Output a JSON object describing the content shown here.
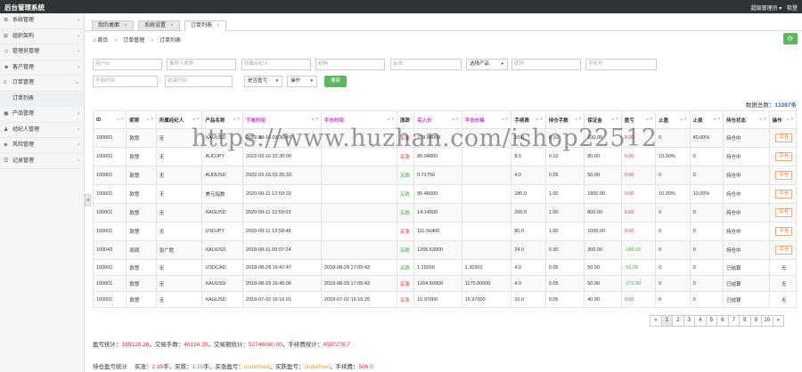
{
  "topbar": {
    "title": "后台管理系统",
    "user": "超级管理员",
    "user_arrow": "▾",
    "logout": "软登"
  },
  "sidebar": {
    "items": [
      {
        "label": "系统管理",
        "icon": "gear-icon",
        "glyph": "⚙",
        "expanded": false
      },
      {
        "label": "组织架构",
        "icon": "org-icon",
        "glyph": "⊞",
        "expanded": false
      },
      {
        "label": "管理员管理",
        "icon": "user-icon",
        "glyph": "☺",
        "expanded": false
      },
      {
        "label": "客户管理",
        "icon": "customer-icon",
        "glyph": "☻",
        "expanded": false
      },
      {
        "label": "订单管理",
        "icon": "order-icon",
        "glyph": "≡",
        "expanded": true
      },
      {
        "label": "订单列表",
        "sub": true
      },
      {
        "label": "产品管理",
        "icon": "product-icon",
        "glyph": "▣",
        "expanded": false
      },
      {
        "label": "经纪人管理",
        "icon": "agent-icon",
        "glyph": "♟",
        "expanded": false
      },
      {
        "label": "风险管理",
        "icon": "risk-icon",
        "glyph": "◈",
        "expanded": false
      },
      {
        "label": "记录管理",
        "icon": "record-icon",
        "glyph": "☰",
        "expanded": false
      }
    ],
    "collapse": "◂"
  },
  "tabs": [
    {
      "label": "我的桌面",
      "active": false
    },
    {
      "label": "系统设置",
      "active": false
    },
    {
      "label": "订单列表",
      "active": true
    }
  ],
  "tab_close": "×",
  "breadcrumb": {
    "home": "首页",
    "level1": "订单管理",
    "level2": "订单列表",
    "sep": ">"
  },
  "refresh_glyph": "⟳",
  "filters": {
    "user_id": "用户Id",
    "recommender": "推荐人昵称",
    "agent": "所属经纪人",
    "org": "机构",
    "member": "会员",
    "product": "选择产品",
    "nickname": "昵称",
    "phone": "手机号",
    "start_time": "开始时间",
    "end_time": "结束时间",
    "holding": "是否盈亏",
    "operation": "操作",
    "search": "搜索",
    "range_sep": "-"
  },
  "total": {
    "label": "数据总数：",
    "value": "13287",
    "unit": "条"
  },
  "table": {
    "headers": [
      "ID",
      "昵称",
      "所属经纪人",
      "产品名称",
      "下单时间",
      "平仓时间",
      "涨跌",
      "买入价",
      "平仓价格",
      "手续费",
      "持仓手数",
      "保证金",
      "盈亏",
      "止盈",
      "止损",
      "持仓状态",
      "操作"
    ],
    "rows": [
      [
        "100001",
        "款慧",
        "无",
        "XAUUSD",
        "2022-03-16 02:30:47",
        "",
        "买涨",
        "779.96000",
        "",
        "10.0",
        "0.10",
        "100.00",
        "0.00",
        "0",
        "40.00%",
        "持仓中",
        "平仓"
      ],
      [
        "100001",
        "款慧",
        "无",
        "AUDJPY",
        "2022-03-16 02:30:09",
        "",
        "买涨",
        "80.04800",
        "",
        "8.0",
        "0.10",
        "80.00",
        "0.00",
        "10.00%",
        "0",
        "持仓中",
        "平仓"
      ],
      [
        "100001",
        "款慧",
        "无",
        "AUDUSD",
        "2022-03-16 02:25:33",
        "",
        "买跌",
        "0.71750",
        "",
        "4.0",
        "0.05",
        "50.00",
        "0.00",
        "0",
        "0",
        "持仓中",
        "平仓"
      ],
      [
        "100001",
        "款慧",
        "无",
        "美元指数",
        "2020-09-11 12:59:19",
        "",
        "买跌",
        "95.48000",
        "",
        "180.0",
        "1.00",
        "1800.00",
        "0.00",
        "10.00%",
        "10.00%",
        "持仓中",
        "平仓"
      ],
      [
        "100001",
        "款慧",
        "无",
        "XAGUSD",
        "2020-09-11 12:59:03",
        "",
        "买跌",
        "14.14500",
        "",
        "200.0",
        "1.00",
        "800.00",
        "0.00",
        "0",
        "0",
        "持仓中",
        "平仓"
      ],
      [
        "100001",
        "款慧",
        "无",
        "USDJPY",
        "2020-09-11 12:58:48",
        "",
        "买涨",
        "111.56400",
        "",
        "80.0",
        "1.00",
        "1000.00",
        "0.00",
        "0",
        "0",
        "持仓中",
        "平仓"
      ],
      [
        "100043",
        "闻闻",
        "张广胜",
        "XAUUSD",
        "2018-09-11 00:07:24",
        "",
        "买跌",
        "1206.63000",
        "",
        "24.0",
        "0.30",
        "300.00",
        "-186.10",
        "0",
        "0",
        "持仓中",
        "平仓"
      ],
      [
        "100001",
        "款慧",
        "无",
        "USDCAD",
        "2018-08-29 16:47:47",
        "2018-08-29 17:05:43",
        "买跌",
        "1.29260",
        "1.30301",
        "4.0",
        "0.05",
        "50.00",
        "-52.05",
        "0",
        "0",
        "已结算",
        "无"
      ],
      [
        "100001",
        "款慧",
        "无",
        "XAUUSD",
        "2018-08-29 16:45:06",
        "2018-08-29 17:05:43",
        "买涨",
        "1204.50000",
        "1170.00000",
        "4.0",
        "0.05",
        "50.00",
        "-172.50",
        "0",
        "0",
        "已结算",
        "无"
      ],
      [
        "100001",
        "款慧",
        "无",
        "XAGUSD",
        "2018-07-02 16:16:01",
        "2018-07-02 16:16:25",
        "买涨",
        "15.97000",
        "15.97000",
        "10.0",
        "0.05",
        "40.00",
        "0.00",
        "0",
        "0",
        "已结算",
        "无"
      ]
    ]
  },
  "pagination": {
    "prev": "«",
    "pages": [
      "1",
      "2",
      "3",
      "4",
      "5",
      "6",
      "7",
      "8",
      "9",
      "10"
    ],
    "next": "»",
    "current": "1"
  },
  "summary1": {
    "profit_label": "盈亏统计：",
    "profit_value": "185128.26",
    "fee_label": "，交易手数：",
    "fee_value": "46194.35",
    "amount_label": "，交易额统计：",
    "amount_value": "52746080.00",
    "commission_label": "，手续费统计：",
    "commission_value": "4597278.7"
  },
  "summary2": {
    "title": "持仓盈亏统计",
    "buy_up_label": "买涨：",
    "buy_up_value": "2.35",
    "buy_up_unit": "手",
    "buy_down_label": "，买跌：",
    "buy_down_value": "1.20",
    "buy_down_unit": "手",
    "up_pl_label": "，买涨盈亏：",
    "up_pl_value": "undefined",
    "down_pl_label": "，买跌盈亏：",
    "down_pl_value": "undefined",
    "fee_label": "，手续费：",
    "fee_value": "506.0"
  },
  "watermark": "https://www.huzhan.com/ishop22512",
  "colors": {
    "accent_green": "#5cb85c",
    "topbar": "#2f3437",
    "loss_green": "#3ab03a",
    "buy_up_red": "#e03030",
    "link_pink": "#d030d0"
  }
}
